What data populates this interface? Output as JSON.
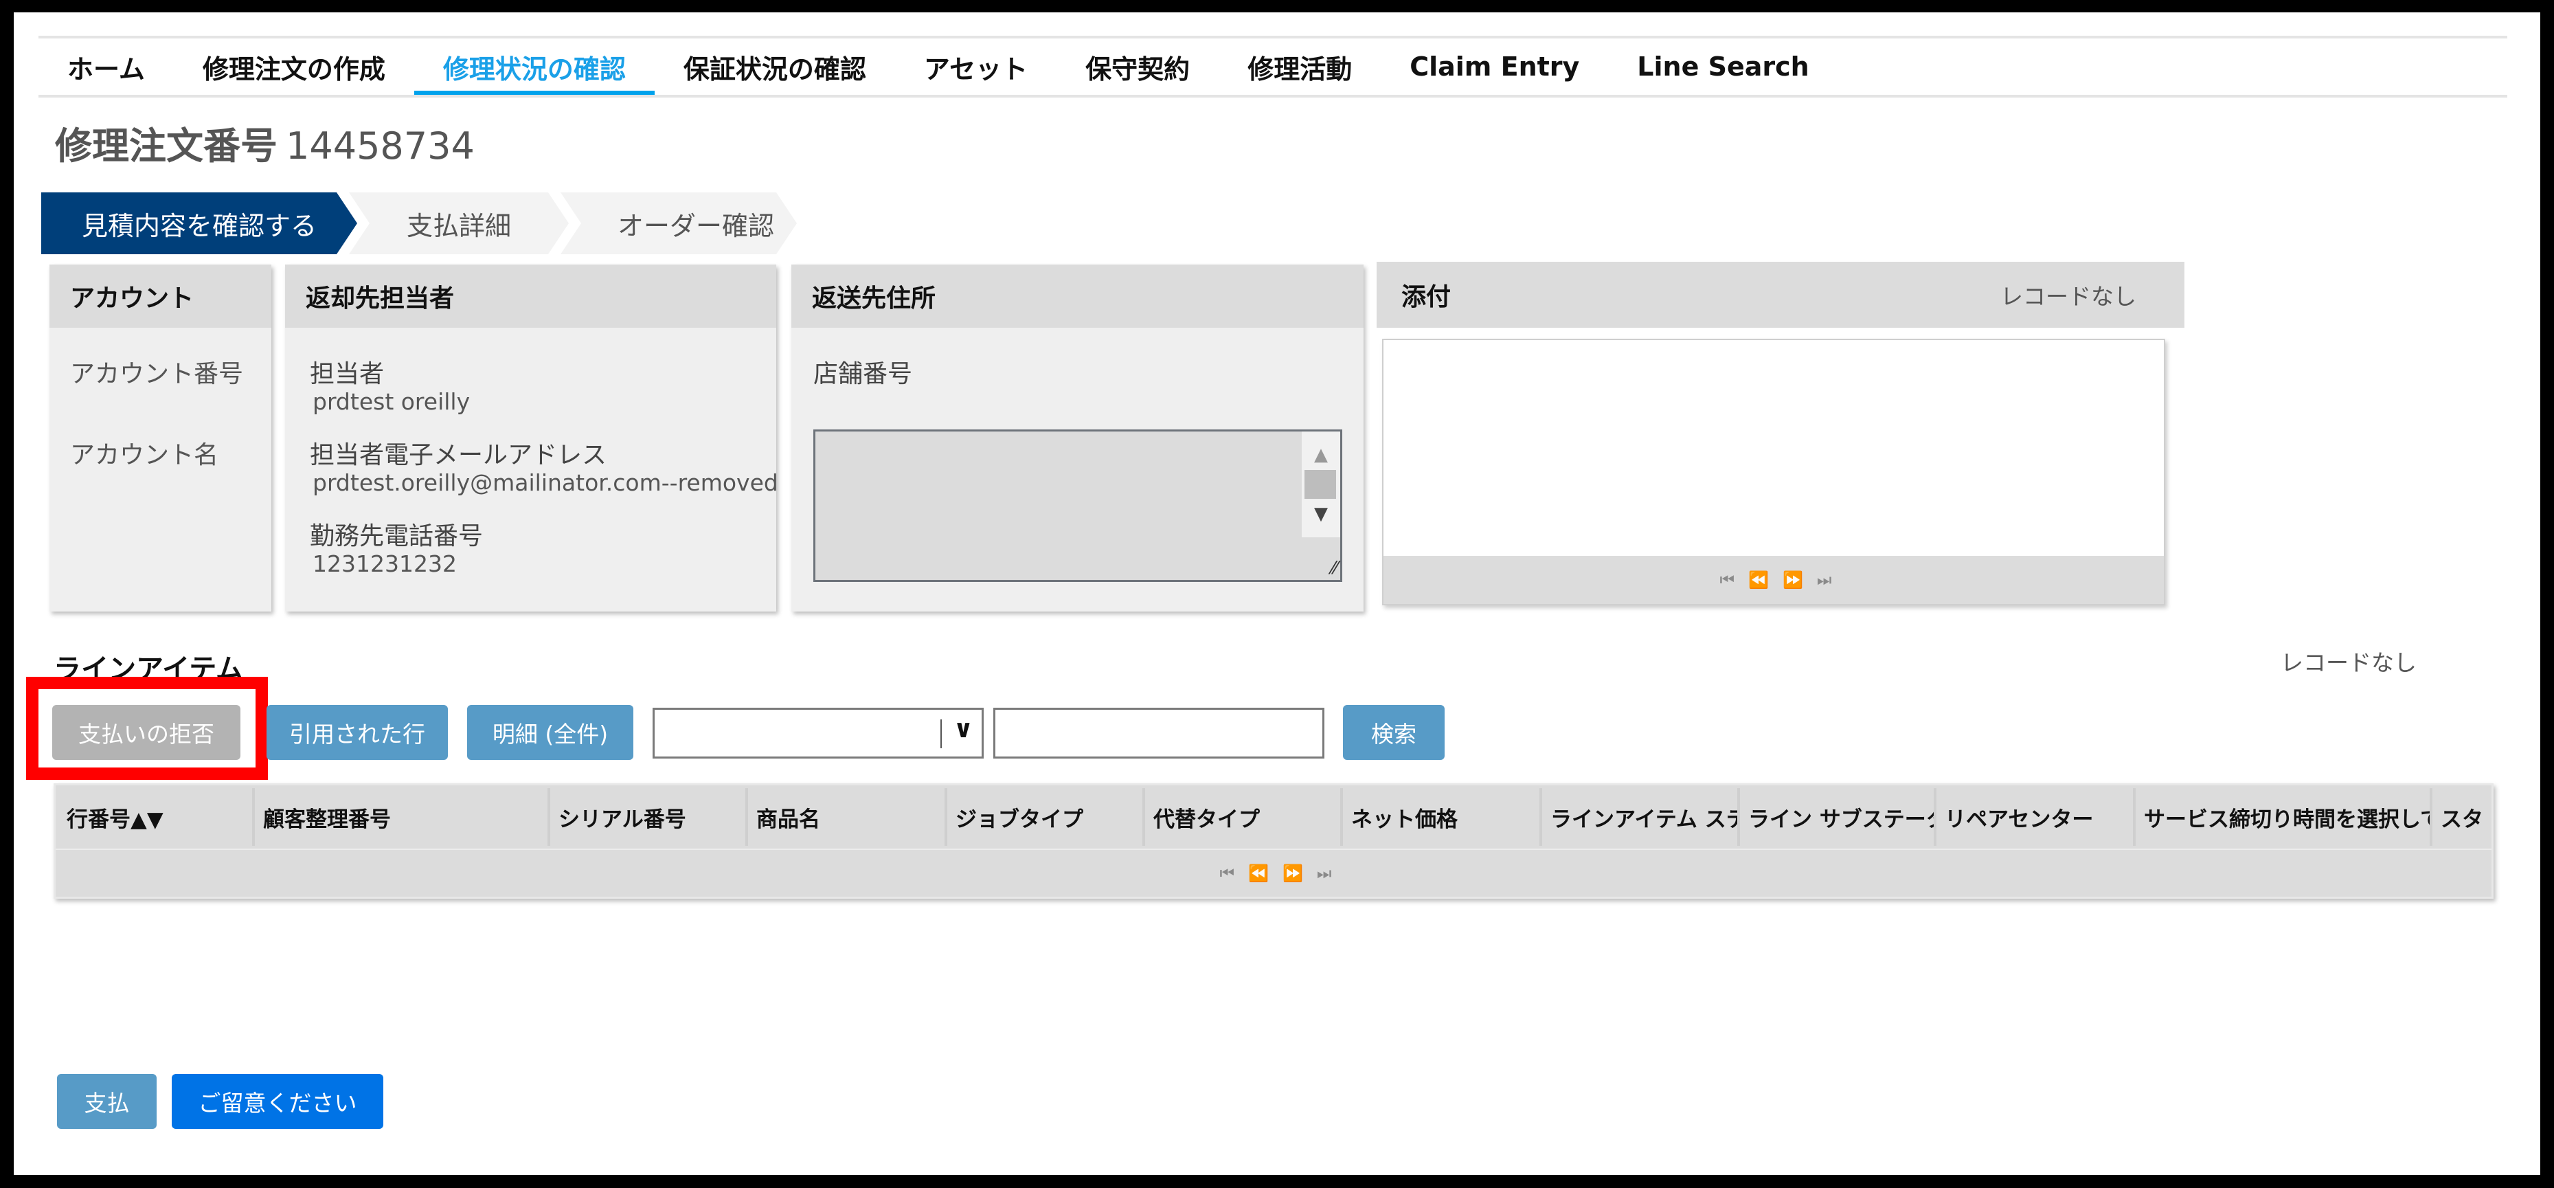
{
  "nav": {
    "items": [
      {
        "label": "ホーム",
        "active": false
      },
      {
        "label": "修理注文の作成",
        "active": false
      },
      {
        "label": "修理状況の確認",
        "active": true
      },
      {
        "label": "保証状況の確認",
        "active": false
      },
      {
        "label": "アセット",
        "active": false
      },
      {
        "label": "保守契約",
        "active": false
      },
      {
        "label": "修理活動",
        "active": false
      },
      {
        "label": "Claim Entry",
        "active": false
      },
      {
        "label": "Line Search",
        "active": false
      }
    ]
  },
  "header": {
    "title_label": "修理注文番号",
    "order_number": "14458734"
  },
  "steps": [
    {
      "label": "見積内容を確認する",
      "active": true
    },
    {
      "label": "支払詳細",
      "active": false
    },
    {
      "label": "オーダー確認",
      "active": false
    }
  ],
  "account_card": {
    "title": "アカウント",
    "account_number_label": "アカウント番号",
    "account_number_value": "",
    "account_name_label": "アカウント名",
    "account_name_value": ""
  },
  "contact_card": {
    "title": "返却先担当者",
    "contact_label": "担当者",
    "contact_value": "prdtest oreilly",
    "email_label": "担当者電子メールアドレス",
    "email_value": "prdtest.oreilly@mailinator.com--removed",
    "phone_label": "勤務先電話番号",
    "phone_value": "1231231232"
  },
  "address_card": {
    "title": "返送先住所",
    "store_number_label": "店舗番号",
    "address_value": ""
  },
  "attachments": {
    "title": "添付",
    "record_status": "レコードなし",
    "pager": {
      "first": "⏮",
      "prev": "⏪",
      "next": "⏩",
      "last": "⏭"
    }
  },
  "line_items": {
    "title": "ラインアイテム",
    "record_status": "レコードなし",
    "buttons": {
      "reject_payment": "支払いの拒否",
      "quoted_lines": "引用された行",
      "details_all": "明細 (全件)",
      "search": "検索"
    },
    "filter_select_value": "",
    "filter_input_value": "",
    "columns": [
      "行番号▲▼",
      "顧客整理番号",
      "シリアル番号",
      "商品名",
      "ジョブタイプ",
      "代替タイプ",
      "ネット価格",
      "ラインアイテム ステ",
      "ライン サブステータ",
      "リペアセンター",
      "サービス締切り時間を選択して",
      "スタ"
    ],
    "rows": [],
    "pager": {
      "first": "⏮",
      "prev": "⏪",
      "next": "⏩",
      "last": "⏭"
    }
  },
  "footer": {
    "pay_button": "支払",
    "notice_button": "ご留意ください"
  },
  "colors": {
    "accent_nav": "#00a2ec",
    "step_active": "#003f7a",
    "button_steel": "#579bc7",
    "button_primary": "#0073e6",
    "button_disabled": "#b3b3b3",
    "highlight": "#ff0000"
  }
}
